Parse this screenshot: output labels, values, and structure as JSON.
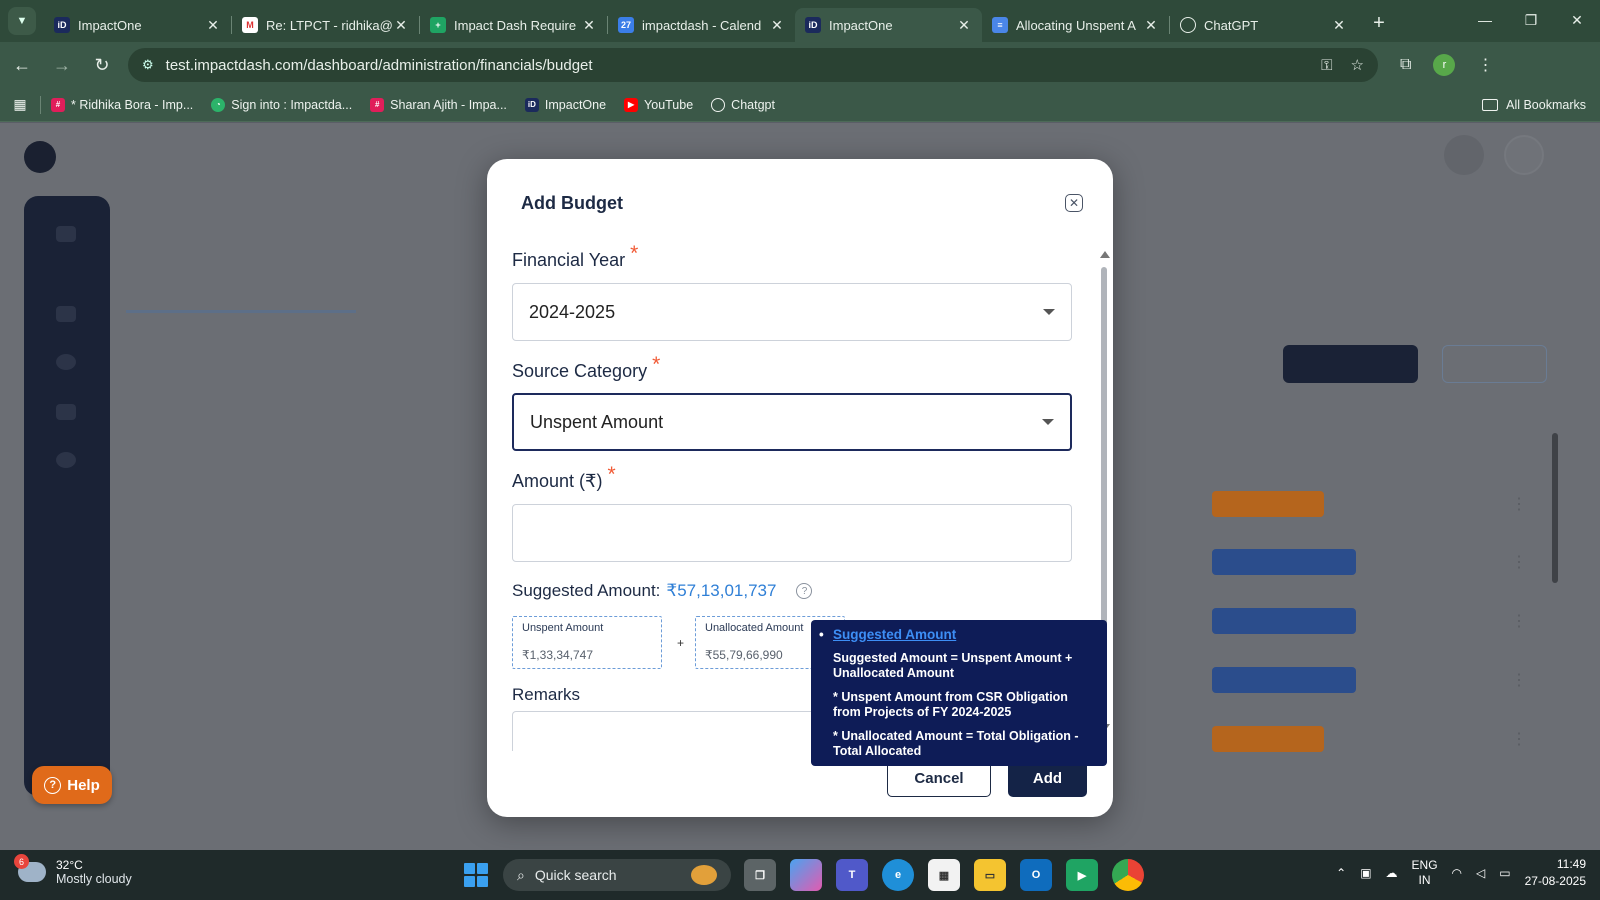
{
  "browser": {
    "tabs": [
      {
        "title": "ImpactOne",
        "favicon": "impactone-icon",
        "active": false
      },
      {
        "title": "Re: LTPCT - ridhika@i",
        "favicon": "gmail-icon",
        "active": false
      },
      {
        "title": "Impact Dash Require",
        "favicon": "sheets-icon",
        "active": false
      },
      {
        "title": "impactdash - Calend",
        "favicon": "calendar-icon",
        "active": false
      },
      {
        "title": "ImpactOne",
        "favicon": "impactone-icon",
        "active": true
      },
      {
        "title": "Allocating Unspent A",
        "favicon": "docs-icon",
        "active": false
      },
      {
        "title": "ChatGPT",
        "favicon": "chatgpt-icon",
        "active": false
      }
    ],
    "url": "test.impactdash.com/dashboard/administration/financials/budget",
    "profile_initial": "r",
    "bookmarks": [
      {
        "label": "* Ridhika Bora - Imp...",
        "icon": "slack-icon"
      },
      {
        "label": "Sign into : Impactda...",
        "icon": "impactdash-icon"
      },
      {
        "label": "Sharan Ajith - Impa...",
        "icon": "slack-icon"
      },
      {
        "label": "ImpactOne",
        "icon": "impactone-icon"
      },
      {
        "label": "YouTube",
        "icon": "youtube-icon"
      },
      {
        "label": "Chatgpt",
        "icon": "chatgpt-icon"
      }
    ],
    "all_bookmarks": "All Bookmarks"
  },
  "modal": {
    "title": "Add Budget",
    "financial_year": {
      "label": "Financial Year",
      "value": "2024-2025"
    },
    "source_category": {
      "label": "Source Category",
      "value": "Unspent Amount"
    },
    "amount": {
      "label": "Amount (₹)",
      "value": ""
    },
    "suggested": {
      "label": "Suggested Amount:",
      "value": "₹57,13,01,737"
    },
    "unspent": {
      "label": "Unspent Amount",
      "value": "₹1,33,34,747"
    },
    "unallocated": {
      "label": "Unallocated Amount",
      "value": "₹55,79,66,990"
    },
    "plus": "+",
    "required_mark": "*",
    "remarks": {
      "label": "Remarks",
      "value": ""
    },
    "cancel_label": "Cancel",
    "add_label": "Add"
  },
  "tooltip": {
    "title": "Suggested Amount",
    "line1": "Suggested Amount = Unspent Amount + Unallocated Amount",
    "line2": "* Unspent Amount from CSR Obligation from Projects of FY 2024-2025",
    "line3": "* Unallocated Amount = Total Obligation - Total Allocated"
  },
  "help_label": "Help",
  "taskbar": {
    "weather_badge": "6",
    "temp": "32°C",
    "condition": "Mostly cloudy",
    "search": "Quick search",
    "lang1": "ENG",
    "lang2": "IN",
    "time": "11:49",
    "date": "27-08-2025"
  }
}
